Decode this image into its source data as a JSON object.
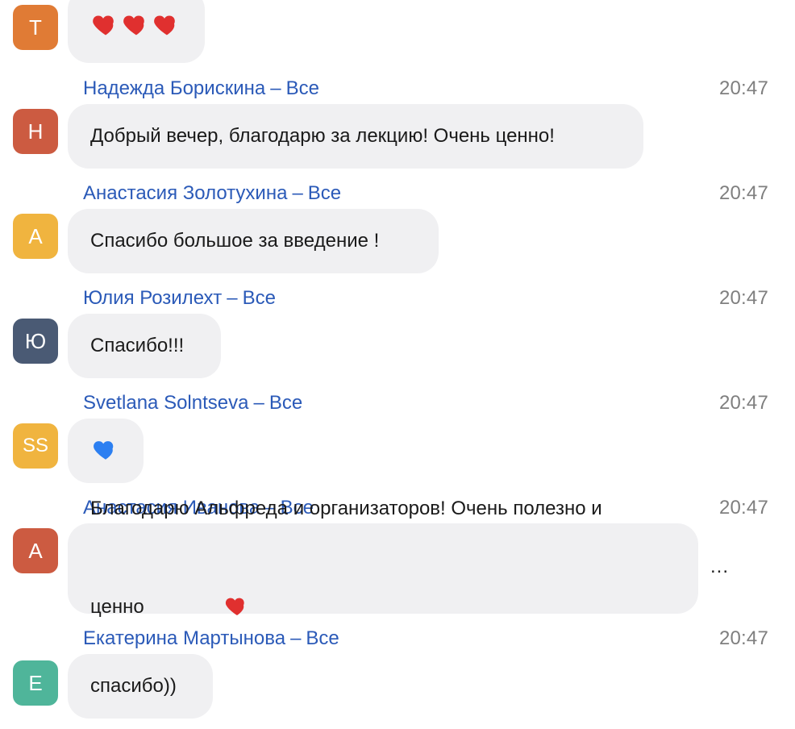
{
  "colors": {
    "name_blue": "#2b5ab8",
    "time_gray": "#7f7f7f",
    "bubble_bg": "#f0f0f2",
    "avatar_t": "#e07b35",
    "avatar_h": "#cc5b41",
    "avatar_a1": "#f0b43f",
    "avatar_yu": "#4a5a74",
    "avatar_ss": "#f0b43f",
    "avatar_a2": "#cc5b41",
    "avatar_e": "#4fb59a"
  },
  "messages": [
    {
      "avatar": "T",
      "sender": "",
      "audience": "",
      "time": "",
      "text": "",
      "icons": [
        "heart-red",
        "heart-red",
        "heart-red"
      ]
    },
    {
      "avatar": "Н",
      "sender": "Надежда Борискина",
      "audience": "Все",
      "time": "20:47",
      "text": "Добрый вечер, благодарю за лекцию! Очень ценно!"
    },
    {
      "avatar": "А",
      "sender": "Анастасия Золотухина",
      "audience": "Все",
      "time": "20:47",
      "text": "Спасибо большое за введение !"
    },
    {
      "avatar": "Ю",
      "sender": "Юлия Розилехт",
      "audience": "Все",
      "time": "20:47",
      "text": "Спасибо!!!"
    },
    {
      "avatar": "SS",
      "sender": "Svetlana Solntseva",
      "audience": "Все",
      "time": "20:47",
      "text": "",
      "icons": [
        "heart-blue"
      ]
    },
    {
      "avatar": "А",
      "sender": "Анастасия Иванова",
      "audience": "Все",
      "time": "20:47",
      "text_line1": "Благодарю Альфреда и организаторов! Очень полезно и",
      "text_line2": "ценно",
      "icons": [
        "heart-red"
      ],
      "more": "..."
    },
    {
      "avatar": "Е",
      "sender": "Екатерина Мартынова",
      "audience": "Все",
      "time": "20:47",
      "text": "спасибо))"
    }
  ],
  "separator": "–"
}
